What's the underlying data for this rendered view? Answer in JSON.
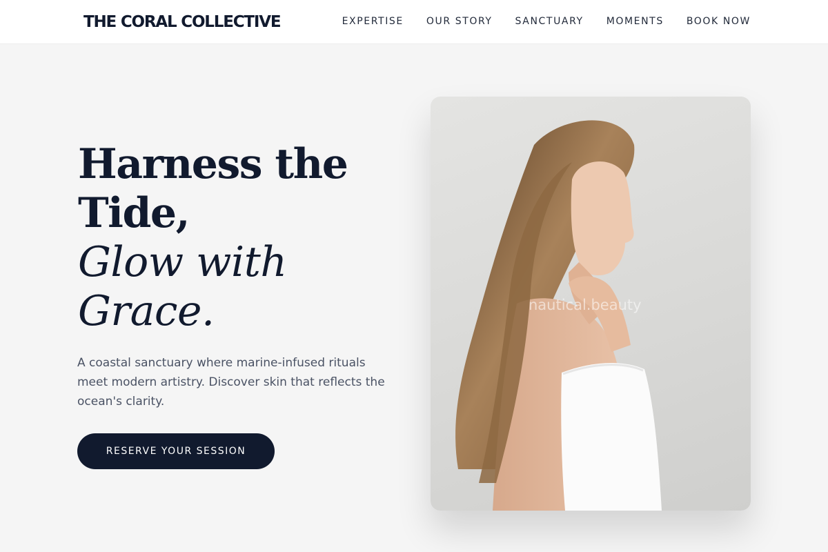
{
  "brand": {
    "name": "THE CORAL COLLECTIVE"
  },
  "nav": {
    "items": [
      {
        "label": "EXPERTISE"
      },
      {
        "label": "OUR STORY"
      },
      {
        "label": "SANCTUARY"
      },
      {
        "label": "MOMENTS"
      },
      {
        "label": "BOOK NOW"
      }
    ]
  },
  "hero": {
    "headline_line1": "Harness the",
    "headline_line2": "Tide,",
    "headline_line3": "Glow with",
    "headline_line4": "Grace.",
    "intro": "A coastal sanctuary where marine-infused rituals meet modern artistry. Discover skin that reflects the ocean's clarity.",
    "cta_label": "RESERVE YOUR SESSION",
    "image": {
      "watermark": "nautical.beauty"
    }
  },
  "colors": {
    "brand_navy": "#111a2e",
    "background": "#f5f5f5",
    "body_text": "#4a5264",
    "header_bg": "#ffffff"
  }
}
